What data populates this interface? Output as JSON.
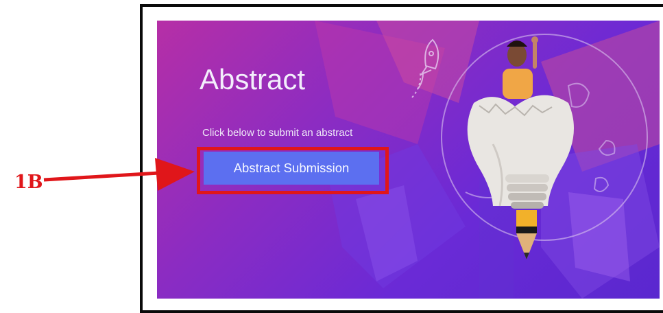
{
  "banner": {
    "title": "Abstract",
    "subtitle": "Click below to submit an abstract",
    "submit_button_label": "Abstract Submission"
  },
  "annotation": {
    "label": "1B",
    "color": "#e0161a"
  },
  "colors": {
    "banner_gradient_start": "#b62fa6",
    "banner_gradient_end": "#5a27cf",
    "button_background": "#5c6ff0",
    "frame_border": "#0a0a0a"
  },
  "icons": [
    "rocket-icon",
    "lightbulb-illustration",
    "pencil-icon",
    "globe-icon"
  ]
}
